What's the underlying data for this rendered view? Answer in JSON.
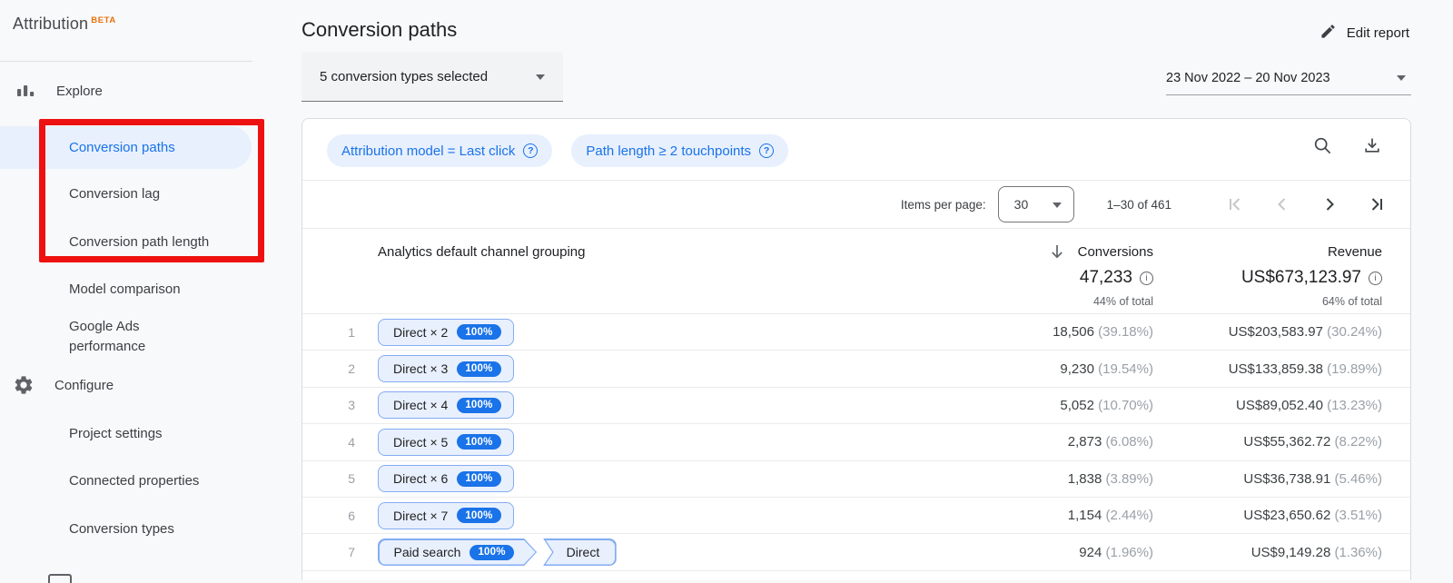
{
  "sidebar": {
    "title": "Attribution",
    "beta": "BETA",
    "sections": [
      {
        "label": "Explore",
        "items": [
          "Conversion paths",
          "Conversion lag",
          "Conversion path length",
          "Model comparison",
          "Google Ads performance"
        ]
      },
      {
        "label": "Configure",
        "items": [
          "Project settings",
          "Connected properties",
          "Conversion types"
        ]
      }
    ],
    "selected_item": "Conversion paths"
  },
  "header": {
    "title": "Conversion paths",
    "conversion_types": "5 conversion types selected",
    "edit_report": "Edit report",
    "date_range": "23 Nov 2022 – 20 Nov 2023"
  },
  "filters": [
    {
      "label": "Attribution model = Last click"
    },
    {
      "label": "Path length ≥ 2 touchpoints"
    }
  ],
  "pagination": {
    "items_per_page_label": "Items per page:",
    "items_per_page": "30",
    "range": "1–30 of 461"
  },
  "table": {
    "dimension_header": "Analytics default channel grouping",
    "conversions": {
      "label": "Conversions",
      "total": "47,233",
      "share": "44% of total"
    },
    "revenue": {
      "label": "Revenue",
      "total": "US$673,123.97",
      "share": "64% of total"
    },
    "rows": [
      {
        "index": "1",
        "path": [
          {
            "label": "Direct × 2",
            "badge": "100%"
          }
        ],
        "conversions": "18,506",
        "conversions_pct": "(39.18%)",
        "revenue": "US$203,583.97",
        "revenue_pct": "(30.24%)"
      },
      {
        "index": "2",
        "path": [
          {
            "label": "Direct × 3",
            "badge": "100%"
          }
        ],
        "conversions": "9,230",
        "conversions_pct": "(19.54%)",
        "revenue": "US$133,859.38",
        "revenue_pct": "(19.89%)"
      },
      {
        "index": "3",
        "path": [
          {
            "label": "Direct × 4",
            "badge": "100%"
          }
        ],
        "conversions": "5,052",
        "conversions_pct": "(10.70%)",
        "revenue": "US$89,052.40",
        "revenue_pct": "(13.23%)"
      },
      {
        "index": "4",
        "path": [
          {
            "label": "Direct × 5",
            "badge": "100%"
          }
        ],
        "conversions": "2,873",
        "conversions_pct": "(6.08%)",
        "revenue": "US$55,362.72",
        "revenue_pct": "(8.22%)"
      },
      {
        "index": "5",
        "path": [
          {
            "label": "Direct × 6",
            "badge": "100%"
          }
        ],
        "conversions": "1,838",
        "conversions_pct": "(3.89%)",
        "revenue": "US$36,738.91",
        "revenue_pct": "(5.46%)"
      },
      {
        "index": "6",
        "path": [
          {
            "label": "Direct × 7",
            "badge": "100%"
          }
        ],
        "conversions": "1,154",
        "conversions_pct": "(2.44%)",
        "revenue": "US$23,650.62",
        "revenue_pct": "(3.51%)"
      },
      {
        "index": "7",
        "path": [
          {
            "label": "Paid search",
            "badge": "100%",
            "shape": "arrow"
          },
          {
            "label": "Direct",
            "shape": "notch"
          }
        ],
        "conversions": "924",
        "conversions_pct": "(1.96%)",
        "revenue": "US$9,149.28",
        "revenue_pct": "(1.36%)"
      }
    ]
  },
  "icons": {
    "explore": "bar-chart",
    "configure": "gear",
    "edit_report": "pencil",
    "toolbar": [
      "magnifier",
      "download-tray"
    ],
    "sort": "arrow-down",
    "chip_help": "?",
    "total_info": "i",
    "pager": [
      "first-page",
      "chevron-left",
      "chevron-right",
      "last-page"
    ],
    "select_caret": "triangle-down"
  },
  "colors": {
    "accent_blue": "#1a73e8",
    "chip_bg": "#e8f0fe",
    "chip_border": "#84acf1",
    "badge_bg": "#1a73e8",
    "annotation_red": "#ee1111",
    "beta_orange": "#e8710a",
    "page_bg": "#f8f9fa"
  }
}
